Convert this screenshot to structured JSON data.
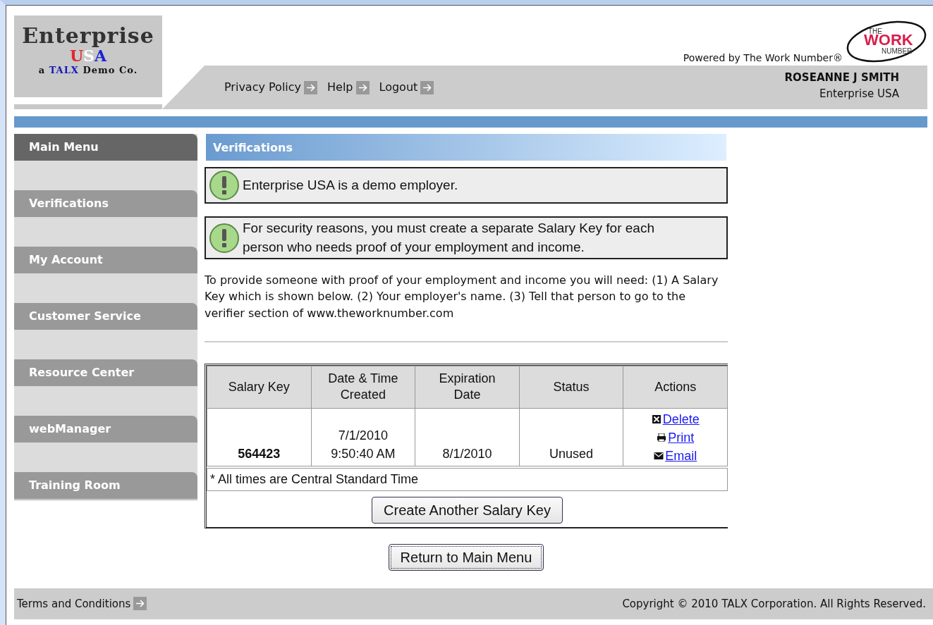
{
  "logo": {
    "title": "Enterprise",
    "mark_letters": [
      {
        "text": "U",
        "color": "#e4262c"
      },
      {
        "text": "S",
        "color": "#ffffff"
      },
      {
        "text": "A",
        "color": "#1a22d8"
      }
    ],
    "tagline": [
      {
        "text": "a ",
        "color": "#111111"
      },
      {
        "text": "TALX",
        "color": "#1616b8"
      },
      {
        "text": " Demo Co.",
        "color": "#111111"
      }
    ]
  },
  "powered_by": "Powered by The Work Number®",
  "brand_logo": {
    "top": "THE",
    "main": "WORK",
    "bottom": "NUMBER"
  },
  "header_links": [
    "Privacy Policy",
    "Help",
    "Logout"
  ],
  "user": {
    "name": "ROSEANNE J SMITH",
    "company": "Enterprise USA"
  },
  "sidebar": {
    "items": [
      {
        "label": "Main Menu",
        "selected": true
      },
      {
        "label": "Verifications",
        "selected": false
      },
      {
        "label": "My Account",
        "selected": false
      },
      {
        "label": "Customer Service",
        "selected": false
      },
      {
        "label": "Resource Center",
        "selected": false
      },
      {
        "label": "webManager",
        "selected": false
      },
      {
        "label": "Training Room",
        "selected": false
      }
    ]
  },
  "section_title": "Verifications",
  "alerts": [
    "Enterprise USA is a demo employer.",
    "For security reasons, you must create a separate Salary Key for each person who needs proof of your employment and income."
  ],
  "instructions": "To provide someone with proof of your employment and income you will need: (1) A Salary Key which is shown below. (2) Your employer's name. (3) Tell that person to go to the verifier section of www.theworknumber.com",
  "table": {
    "columns": [
      "Salary Key",
      "Date & Time Created",
      "Expiration Date",
      "Status",
      "Actions"
    ],
    "rows": [
      {
        "salary_key": "564423",
        "created": "7/1/2010\n9:50:40 AM",
        "expiration": "8/1/2010",
        "status": "Unused",
        "actions": [
          {
            "kind": "delete",
            "label": "Delete"
          },
          {
            "kind": "print",
            "label": "Print"
          },
          {
            "kind": "email",
            "label": "Email"
          }
        ]
      }
    ],
    "footnote": "* All times are Central Standard Time"
  },
  "create_button": "Create Another Salary Key",
  "return_button": "Return to Main Menu",
  "footer": {
    "link": "Terms and Conditions",
    "copyright": "Copyright © 2010 TALX Corporation. All Rights Reserved."
  }
}
